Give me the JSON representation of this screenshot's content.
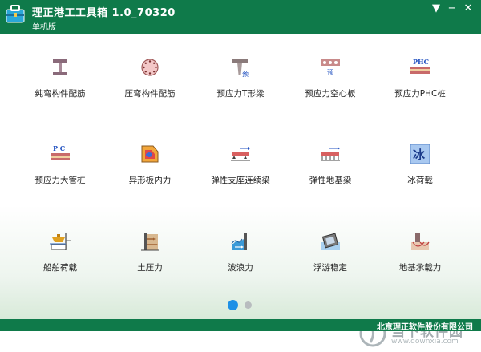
{
  "app": {
    "title": "理正港工工具箱 1.0_70320",
    "edition": "单机版",
    "icon": "toolbox-icon"
  },
  "window_controls": {
    "menu": "▼",
    "minimize": "−",
    "close": "✕"
  },
  "tools": [
    {
      "label": "纯弯构件配筋",
      "icon": "i-beam-icon"
    },
    {
      "label": "压弯构件配筋",
      "icon": "circular-section-icon"
    },
    {
      "label": "预应力T形梁",
      "icon": "t-beam-icon",
      "icon_text": "预"
    },
    {
      "label": "预应力空心板",
      "icon": "hollow-slab-icon",
      "icon_text": "预"
    },
    {
      "label": "预应力PHC桩",
      "icon": "phc-pile-icon",
      "icon_text": "PHC"
    },
    {
      "label": "预应力大管桩",
      "icon": "pc-pipe-pile-icon",
      "icon_text": "P C"
    },
    {
      "label": "异形板内力",
      "icon": "irregular-plate-icon"
    },
    {
      "label": "弹性支座连续梁",
      "icon": "elastic-support-beam-icon"
    },
    {
      "label": "弹性地基梁",
      "icon": "elastic-foundation-beam-icon"
    },
    {
      "label": "冰荷载",
      "icon": "ice-load-icon",
      "icon_text": "冰"
    },
    {
      "label": "船舶荷载",
      "icon": "ship-load-icon"
    },
    {
      "label": "土压力",
      "icon": "earth-pressure-icon"
    },
    {
      "label": "波浪力",
      "icon": "wave-force-icon"
    },
    {
      "label": "浮游稳定",
      "icon": "floating-stability-icon"
    },
    {
      "label": "地基承载力",
      "icon": "bearing-capacity-icon"
    }
  ],
  "pagination": {
    "current": 1,
    "total": 2
  },
  "watermark": {
    "text": "当下软件园",
    "url": "www.downxia.com"
  },
  "footer": {
    "company": "北京理正软件股份有限公司"
  },
  "colors": {
    "titlebar": "#0f7a4a",
    "accent": "#1e90e6"
  }
}
